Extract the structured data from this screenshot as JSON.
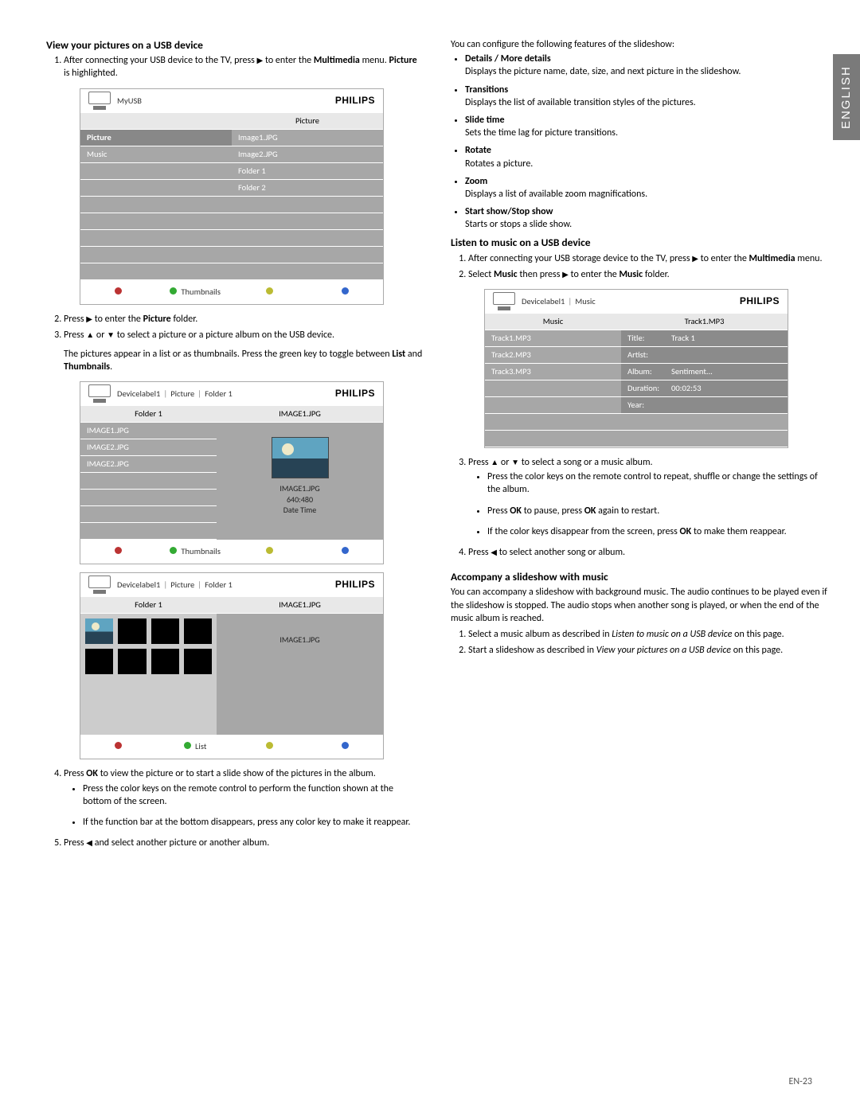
{
  "page_number": "EN-23",
  "language_tab": "ENGLISH",
  "philips_brand": "PHILIPS",
  "section_view_pictures": {
    "title": "View your pictures on a USB device",
    "step1a": "After connecting your USB device to the TV, press ",
    "step1b": " to enter the ",
    "step1c_bold": "Multimedia",
    "step1d": " menu.  ",
    "step1e_bold": "Picture",
    "step1f": " is highlighted.",
    "step2a": "Press ",
    "step2b": " to enter the ",
    "step2c_bold": "Picture",
    "step2d": " folder.",
    "step3a": "Press ",
    "step3b": " or ",
    "step3c": " to select a picture or a picture album on the USB device.",
    "step3_para_a": "The pictures appear in a list or as thumbnails.  Press the green key to toggle between ",
    "step3_para_b_bold": "List",
    "step3_para_c": " and ",
    "step3_para_d_bold": "Thumbnails",
    "step3_para_e": ".",
    "step4a": "Press ",
    "step4b_bold": "OK",
    "step4c": " to view the picture or to start a slide show of the pictures in the album.",
    "step4_sub1": "Press the color keys on the remote control to perform the function shown at the bottom of the screen.",
    "step4_sub2": "If the function bar at the bottom disappears, press any color key to make it reappear.",
    "step5a": "Press ",
    "step5b": " and select another picture or another album."
  },
  "shot1": {
    "breadcrumb": "MyUSB",
    "header_right": "Picture",
    "left_rows": [
      "Picture",
      "Music"
    ],
    "right_rows": [
      "Image1.JPG",
      "Image2.JPG",
      "Folder 1",
      "Folder 2"
    ],
    "footer_label": "Thumbnails"
  },
  "shot2": {
    "breadcrumb": [
      "Devicelabel1",
      "Picture",
      "Folder 1"
    ],
    "left_header": "Folder 1",
    "right_header": "IMAGE1.JPG",
    "left_rows": [
      "IMAGE1.JPG",
      "IMAGE2.JPG",
      "IMAGE2.JPG"
    ],
    "preview_name": "IMAGE1.JPG",
    "preview_res": "640:480",
    "preview_date": "Date    Time",
    "footer_label": "Thumbnails"
  },
  "shot3": {
    "breadcrumb": [
      "Devicelabel1",
      "Picture",
      "Folder 1"
    ],
    "left_header": "Folder 1",
    "right_header": "IMAGE1.JPG",
    "right_label": "IMAGE1.JPG",
    "footer_label": "List"
  },
  "slideshow_intro": "You can configure the following features of the slideshow:",
  "slideshow_items": [
    {
      "title": "Details / More details",
      "desc": "Displays the picture name, date, size, and next picture in the slideshow."
    },
    {
      "title": "Transitions",
      "desc": "Displays the list of available transition styles of the pictures."
    },
    {
      "title": "Slide time",
      "desc": "Sets the time lag for picture transitions."
    },
    {
      "title": "Rotate",
      "desc": "Rotates a picture."
    },
    {
      "title": "Zoom",
      "desc": "Displays a list of available zoom magnifications."
    },
    {
      "title": "Start show/Stop show",
      "desc": "Starts or stops a slide show."
    }
  ],
  "section_music": {
    "title": "Listen to music on a USB device",
    "step1a": "After connecting your USB storage device to the TV, press ",
    "step1b": " to enter the ",
    "step1c_bold": "Multimedia",
    "step1d": " menu.",
    "step2a": "Select ",
    "step2b_bold": "Music",
    "step2c": " then press ",
    "step2d": " to enter the ",
    "step2e_bold": "Music",
    "step2f": " folder.",
    "step3a": "Press ",
    "step3b": " or ",
    "step3c": " to select a song or a music album.",
    "step3_sub1": "Press the color keys on the remote control to repeat, shuffle or change the settings of the album.",
    "step3_sub2a": "Press ",
    "step3_sub2b_bold": "OK",
    "step3_sub2c": " to pause, press ",
    "step3_sub2d_bold": "OK",
    "step3_sub2e": " again to restart.",
    "step3_sub3a": "If the color keys disappear from the screen, press ",
    "step3_sub3b_bold": "OK",
    "step3_sub3c": " to make them reappear.",
    "step4a": "Press ",
    "step4b": " to select another song or album."
  },
  "shot4": {
    "breadcrumb": [
      "Devicelabel1",
      "Music"
    ],
    "left_header": "Music",
    "right_header": "Track1.MP3",
    "left_rows": [
      "Track1.MP3",
      "Track2.MP3",
      "Track3.MP3"
    ],
    "meta": [
      {
        "k": "Title:",
        "v": "Track 1"
      },
      {
        "k": "Artist:",
        "v": ""
      },
      {
        "k": "Album:",
        "v": "Sentiment..."
      },
      {
        "k": "Duration:",
        "v": "00:02:53"
      },
      {
        "k": "Year:",
        "v": ""
      }
    ]
  },
  "section_accompany": {
    "title": "Accompany a slideshow with music",
    "intro": "You can accompany a slideshow with background music.  The audio continues to be played even if the slideshow is stopped.  The audio stops when another song is played, or when the end of the music album is reached.",
    "step1a": "Select a music album as described in ",
    "step1b_ital": "Listen to music on a USB device",
    "step1c": " on this page.",
    "step2a": "Start a slideshow as described in ",
    "step2b_ital": "View your pictures on a USB device",
    "step2c": " on this page."
  }
}
